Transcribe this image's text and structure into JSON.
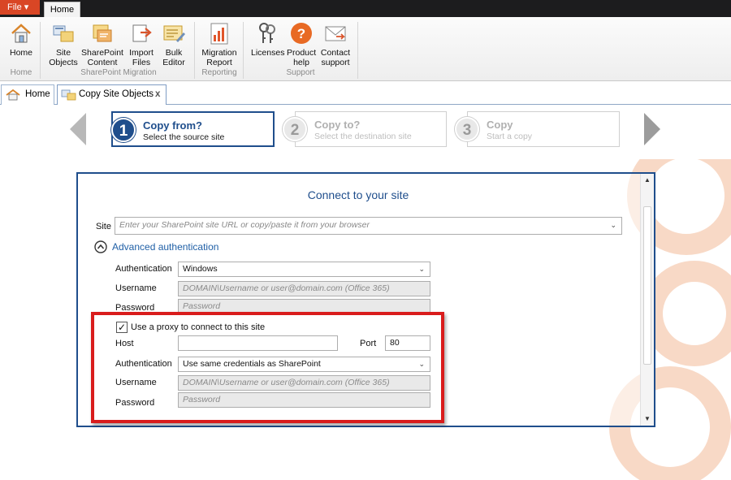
{
  "menubar": {
    "file_label": "File ▾",
    "tab_home": "Home"
  },
  "ribbon": {
    "buttons": [
      {
        "label": "Home",
        "icon": "house-icon"
      },
      {
        "label": "Site Objects",
        "icon": "site-objects-icon"
      },
      {
        "label": "SharePoint Content",
        "icon": "sharepoint-content-icon"
      },
      {
        "label": "Import Files",
        "icon": "import-files-icon"
      },
      {
        "label": "Bulk Editor",
        "icon": "bulk-editor-icon"
      },
      {
        "label": "Migration Report",
        "icon": "chart-report-icon"
      },
      {
        "label": "Licenses",
        "icon": "keys-icon"
      },
      {
        "label": "Product help",
        "icon": "question-icon"
      },
      {
        "label": "Contact support",
        "icon": "envelope-icon"
      }
    ],
    "groups": [
      "Home",
      "SharePoint Migration",
      "Reporting",
      "Support"
    ]
  },
  "doc_tabs": [
    {
      "label": "Home"
    },
    {
      "label": "Copy Site Objects",
      "close": "x"
    }
  ],
  "wizard": {
    "steps": [
      {
        "num": "1",
        "title": "Copy from?",
        "subtitle": "Select the source site",
        "state": "active"
      },
      {
        "num": "2",
        "title": "Copy to?",
        "subtitle": "Select the destination site",
        "state": "disabled"
      },
      {
        "num": "3",
        "title": "Copy",
        "subtitle": "Start a copy",
        "state": "disabled"
      }
    ]
  },
  "panel": {
    "title": "Connect to your site",
    "site_label": "Site",
    "site_placeholder": "Enter your SharePoint site URL or copy/paste it from your browser",
    "advanced_label": "Advanced authentication",
    "auth_label": "Authentication",
    "auth_value": "Windows",
    "username_label": "Username",
    "username_placeholder": "DOMAIN\\Username or user@domain.com (Office 365)",
    "password_label": "Password",
    "password_placeholder": "Password",
    "proxy": {
      "checkbox_label": "Use a proxy to connect to this site",
      "checked": true,
      "host_label": "Host",
      "host_value": "",
      "port_label": "Port",
      "port_value": "80",
      "auth_label": "Authentication",
      "auth_value": "Use same credentials as SharePoint",
      "username_label": "Username",
      "username_placeholder": "DOMAIN\\Username or user@domain.com (Office 365)",
      "password_label": "Password",
      "password_placeholder": "Password"
    }
  },
  "colors": {
    "accent": "#1f4e8c",
    "highlight": "#d91c1c",
    "file_tab": "#d94625",
    "deco": "#f6d2bd"
  }
}
